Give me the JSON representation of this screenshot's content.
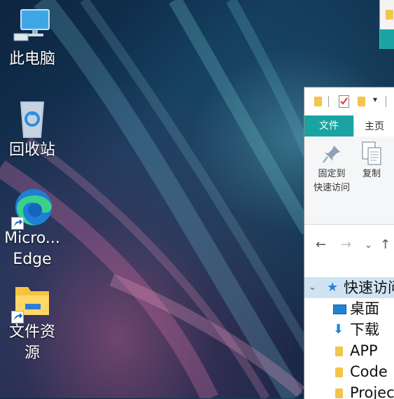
{
  "desktop": {
    "icons": [
      {
        "label": "此电脑",
        "icon": "computer-icon"
      },
      {
        "label": "回收站",
        "icon": "recycle-bin-icon"
      },
      {
        "label_line1": "Micro...",
        "label_line2": "Edge",
        "icon": "edge-icon"
      },
      {
        "label_line1": "文件资",
        "label_line2": "源",
        "icon": "file-explorer-icon"
      }
    ]
  },
  "explorer": {
    "tabs": {
      "file": "文件",
      "home": "主页"
    },
    "ribbon": {
      "pin_line1": "固定到",
      "pin_line2": "快速访问",
      "copy": "复制"
    },
    "tree": [
      {
        "label": "快速访问",
        "icon": "quick-access-star-icon"
      },
      {
        "label": "桌面",
        "icon": "desktop-icon"
      },
      {
        "label": "下载",
        "icon": "download-arrow-icon"
      },
      {
        "label": "APP",
        "icon": "folder-icon"
      },
      {
        "label": "Code",
        "icon": "folder-icon"
      },
      {
        "label": "Projec",
        "icon": "folder-icon"
      }
    ]
  },
  "colors": {
    "accent": "#1aa3a3",
    "selection": "#cfe3f3"
  }
}
